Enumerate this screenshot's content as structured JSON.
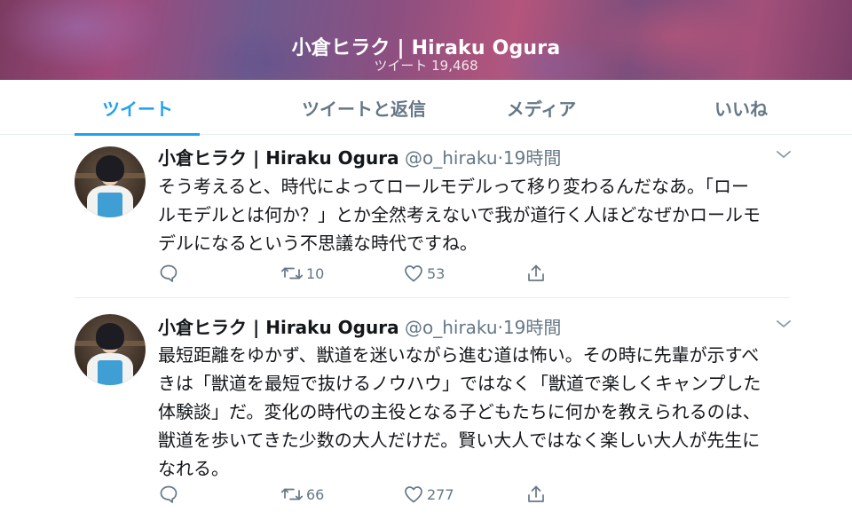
{
  "header": {
    "title": "小倉ヒラク | Hiraku Ogura",
    "subtitle": "ツイート 19,468"
  },
  "tabs": [
    {
      "label": "ツイート",
      "active": true
    },
    {
      "label": "ツイートと返信",
      "active": false
    },
    {
      "label": "メディア",
      "active": false
    },
    {
      "label": "いいね",
      "active": false
    }
  ],
  "tweets": [
    {
      "name": "小倉ヒラク | Hiraku Ogura",
      "handle": "@o_hiraku",
      "separator": "·",
      "time": "19時間",
      "lines": [
        "そう考えると、時代によってロールモデルって移り変わるんだなあ。「ロー",
        "ルモデルとは何か？」とか全然考えないで我が道行く人ほどなぜかロールモ",
        "デルになるという不思議な時代ですね。"
      ],
      "retweets": "10",
      "likes": "53"
    },
    {
      "name": "小倉ヒラク | Hiraku Ogura",
      "handle": "@o_hiraku",
      "separator": "·",
      "time": "19時間",
      "lines": [
        "最短距離をゆかず、獣道を迷いながら進む道は怖い。その時に先輩が示すべ",
        "きは「獣道を最短で抜けるノウハウ」ではなく「獣道で楽しくキャンプした",
        "体験談」だ。変化の時代の主役となる子どもたちに何かを教えられるのは、",
        "獣道を歩いてきた少数の大人だけだ。賢い大人ではなく楽しい大人が先生に",
        "なれる。"
      ],
      "retweets": "66",
      "likes": "277"
    }
  ],
  "icons": {
    "reply": "reply-icon",
    "retweet": "retweet-icon",
    "like": "heart-icon",
    "share": "share-icon",
    "menu": "chevron-down-icon"
  },
  "colors": {
    "accent": "#1da1f2",
    "secondary_text": "#657786",
    "divider": "#e6ecf0"
  }
}
